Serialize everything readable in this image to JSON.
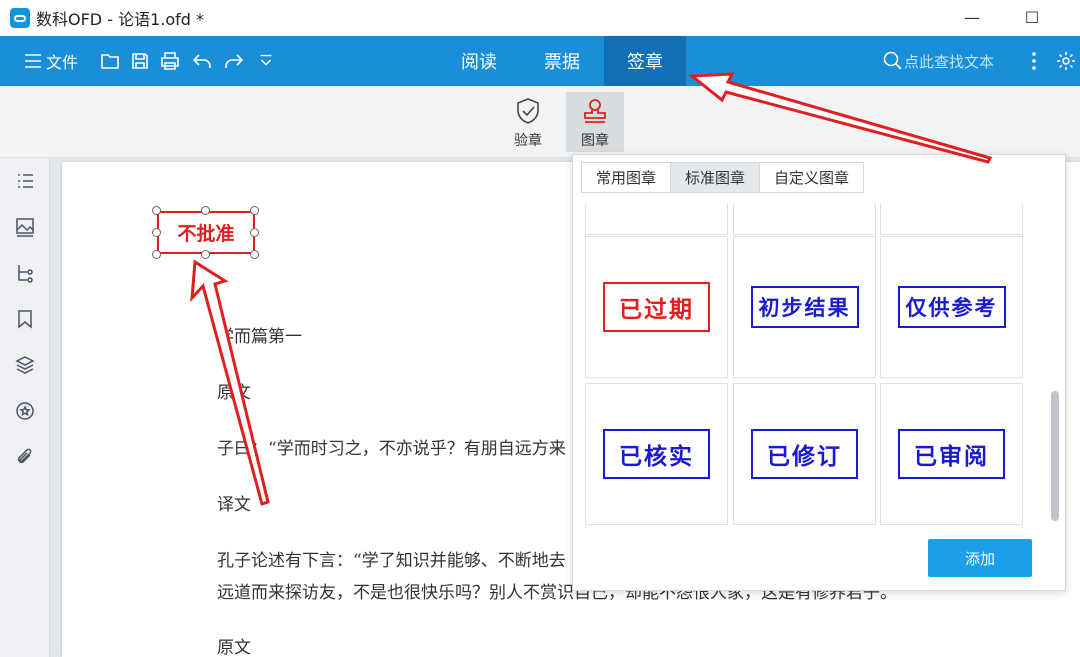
{
  "window": {
    "title": "数科OFD - 论语1.ofd *",
    "minimize": "—",
    "maximize": "☐"
  },
  "toolbar": {
    "file_label": "文件",
    "tabs": [
      {
        "label": "阅读"
      },
      {
        "label": "票据"
      },
      {
        "label": "签章"
      }
    ],
    "search_placeholder": "点此查找文本"
  },
  "ribbon": {
    "verify_label": "验章",
    "stamp_label": "图章"
  },
  "stamp_on_page": {
    "text": "不批准",
    "color": "#e02020"
  },
  "document": {
    "lines": [
      "学而篇第一",
      "原文",
      "子曰：“学而时习之，不亦说乎？有朋自远方来",
      "译文",
      "孔子论述有下言：“学了知识并能够、不断地去",
      "远道而来探访友，不是也很快乐吗？别人不赏识自己，却能不怨恨人家，这是有修养君子。",
      "原文"
    ]
  },
  "stamp_panel": {
    "tabs": [
      "常用图章",
      "标准图章",
      "自定义图章"
    ],
    "active_tab": 1,
    "stamps": [
      {
        "text": "已过期",
        "color": "#e02020"
      },
      {
        "text": "初步结果",
        "color": "#1a1ad0"
      },
      {
        "text": "仅供参考",
        "color": "#1a1ad0"
      },
      {
        "text": "已核实",
        "color": "#1a1ad0"
      },
      {
        "text": "已修订",
        "color": "#1a1ad0"
      },
      {
        "text": "已审阅",
        "color": "#1a1ad0"
      }
    ],
    "add_label": "添加"
  },
  "colors": {
    "toolbar": "#1a8ed8",
    "active_tab": "#136fb4",
    "annotation_arrow": "#e02020"
  }
}
